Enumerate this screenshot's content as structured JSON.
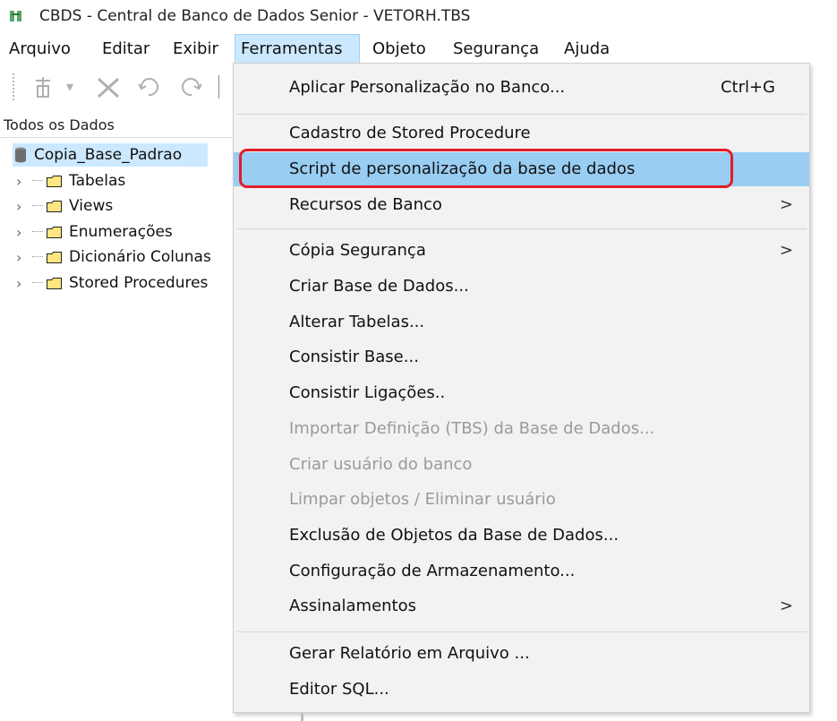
{
  "window": {
    "title": "CBDS - Central de Banco de Dados Senior - VETORH.TBS"
  },
  "menubar": {
    "items": [
      {
        "label": "Arquivo"
      },
      {
        "label": "Editar"
      },
      {
        "label": "Exibir"
      },
      {
        "label": "Ferramentas"
      },
      {
        "label": "Objeto"
      },
      {
        "label": "Segurança"
      },
      {
        "label": "Ajuda"
      }
    ]
  },
  "tree": {
    "header": "Todos os Dados",
    "root": "Copia_Base_Padrao",
    "children": [
      {
        "label": "Tabelas"
      },
      {
        "label": "Views"
      },
      {
        "label": "Enumerações"
      },
      {
        "label": "Dicionário Colunas"
      },
      {
        "label": "Stored Procedures"
      }
    ]
  },
  "menu": {
    "items": [
      {
        "label": "Aplicar Personalização no Banco...",
        "shortcut": "Ctrl+G"
      },
      {
        "label": "Cadastro de Stored Procedure"
      },
      {
        "label": "Script de personalização da base de dados"
      },
      {
        "label": "Recursos de Banco",
        "arrow": ">"
      },
      {
        "label": "Cópia Segurança",
        "arrow": ">"
      },
      {
        "label": "Criar Base de Dados..."
      },
      {
        "label": "Alterar Tabelas..."
      },
      {
        "label": "Consistir Base..."
      },
      {
        "label": "Consistir Ligações.."
      },
      {
        "label": "Importar Definição (TBS) da Base de Dados..."
      },
      {
        "label": "Criar usuário do banco"
      },
      {
        "label": "Limpar objetos / Eliminar usuário"
      },
      {
        "label": "Exclusão de Objetos da Base de Dados..."
      },
      {
        "label": "Configuração de Armazenamento..."
      },
      {
        "label": "Assinalamentos",
        "arrow": ">"
      },
      {
        "label": "Gerar Relatório em Arquivo ..."
      },
      {
        "label": "Editor SQL..."
      }
    ]
  },
  "colors": {
    "highlight": "#99cdf2",
    "menubar_active": "#cce8ff",
    "annotation": "#e21d2a"
  }
}
